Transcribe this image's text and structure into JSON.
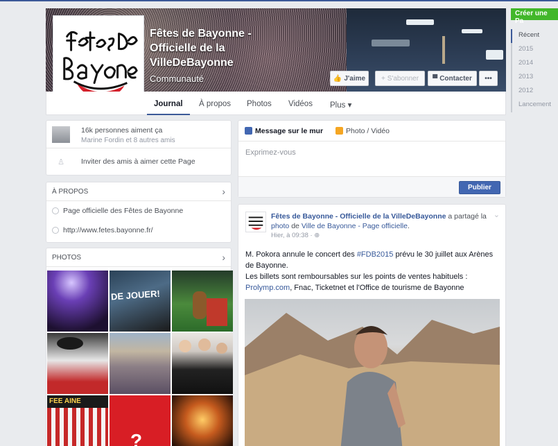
{
  "page": {
    "name": "Fêtes de Bayonne - Officielle de la VilleDeBayonne",
    "category": "Communauté"
  },
  "cover_actions": {
    "like": "J'aime",
    "subscribe": "S'abonner",
    "contact": "Contacter",
    "more": "•••"
  },
  "tabs": [
    "Journal",
    "À propos",
    "Photos",
    "Vidéos",
    "Plus ▾"
  ],
  "timeline": {
    "create_page": "Créer une Pa",
    "years": [
      "Récent",
      "2015",
      "2014",
      "2013",
      "2012",
      "Lancement"
    ]
  },
  "likes": {
    "count_text": "16k personnes aiment ça",
    "friends_text": "Marine Fordin et 8 autres amis",
    "invite_text": "Inviter des amis à aimer cette Page"
  },
  "about": {
    "header": "À PROPOS",
    "description": "Page officielle des Fêtes de Bayonne",
    "website": "http://www.fetes.bayonne.fr/"
  },
  "photos": {
    "header": "PHOTOS"
  },
  "composer": {
    "tab_status": "Message sur le mur",
    "tab_photo": "Photo / Vidéo",
    "placeholder": "Exprimez-vous",
    "publish": "Publier"
  },
  "post": {
    "author": "Fêtes de Bayonne - Officielle de la VilleDeBayonne",
    "action_a": "a",
    "action_shared": "partagé la",
    "photo_word": "photo",
    "of_word": "de",
    "shared_from": "Ville de Bayonne - Page officielle",
    "time": "Hier, à 09:38 · ⊕",
    "line1_pre": "M. Pokora annule le concert des ",
    "hashtag": "#FDB2015",
    "line1_post": " prévu le 30 juillet aux Arènes de Bayonne.",
    "line2_pre": "Les billets sont remboursables sur les points de ventes habituels :",
    "line2_link": "Prolymp.com",
    "line2_post": ", Fnac, Ticketnet et l'Office de tourisme de Bayonne"
  },
  "colors": {
    "facebook_blue": "#3b5998",
    "publish_blue": "#4267b2",
    "create_green": "#42b72a",
    "link_blue": "#365899",
    "logo_red": "#d4202b"
  }
}
